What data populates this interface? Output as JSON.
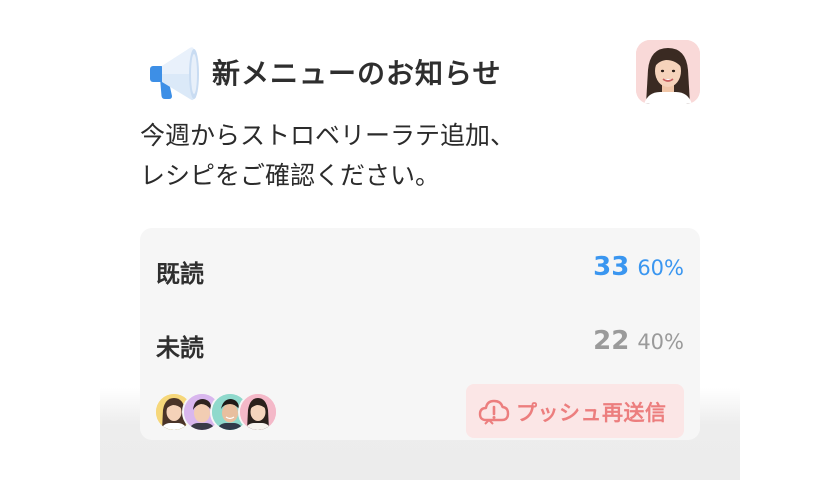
{
  "announcement": {
    "title": "新メニューのお知らせ",
    "message_lines": [
      "今週からストロベリーラテ追加、",
      "レシピをご確認ください。"
    ]
  },
  "stats": {
    "read": {
      "label": "既読",
      "count": "33",
      "percent": "60%"
    },
    "unread": {
      "label": "未読",
      "count": "22",
      "percent": "40%"
    }
  },
  "actions": {
    "push_resend_label": "プッシュ再送信"
  },
  "colors": {
    "accent_blue": "#3a96f0",
    "muted_gray": "#9a9a9a",
    "push_bg": "#fbe6e6",
    "push_text": "#ec7e7e"
  },
  "icons": {
    "header": "megaphone-icon",
    "push": "cloud-alert-icon"
  }
}
